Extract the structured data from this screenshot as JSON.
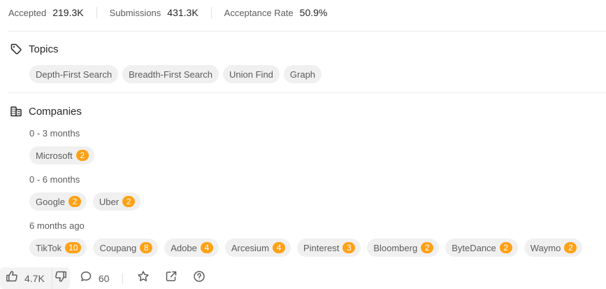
{
  "stats": [
    {
      "label": "Accepted",
      "value": "219.3K"
    },
    {
      "label": "Submissions",
      "value": "431.3K"
    },
    {
      "label": "Acceptance Rate",
      "value": "50.9%"
    }
  ],
  "topics": {
    "title": "Topics",
    "icon": "tag-icon",
    "tags": [
      "Depth-First Search",
      "Breadth-First Search",
      "Union Find",
      "Graph"
    ]
  },
  "companies": {
    "title": "Companies",
    "icon": "building-icon",
    "badge_color": "#ffa116",
    "groups": [
      {
        "period": "0 - 3 months",
        "items": [
          {
            "name": "Microsoft",
            "count": "2"
          }
        ]
      },
      {
        "period": "0 - 6 months",
        "items": [
          {
            "name": "Google",
            "count": "2"
          },
          {
            "name": "Uber",
            "count": "2"
          }
        ]
      },
      {
        "period": "6 months ago",
        "items": [
          {
            "name": "TikTok",
            "count": "10"
          },
          {
            "name": "Coupang",
            "count": "8"
          },
          {
            "name": "Adobe",
            "count": "4"
          },
          {
            "name": "Arcesium",
            "count": "4"
          },
          {
            "name": "Pinterest",
            "count": "3"
          },
          {
            "name": "Bloomberg",
            "count": "2"
          },
          {
            "name": "ByteDance",
            "count": "2"
          },
          {
            "name": "Waymo",
            "count": "2"
          }
        ]
      }
    ]
  },
  "actions": {
    "likes": "4.7K",
    "comments": "60",
    "icons": [
      "thumbs-up-icon",
      "thumbs-down-icon",
      "comment-icon",
      "star-icon",
      "share-icon",
      "help-icon"
    ]
  }
}
